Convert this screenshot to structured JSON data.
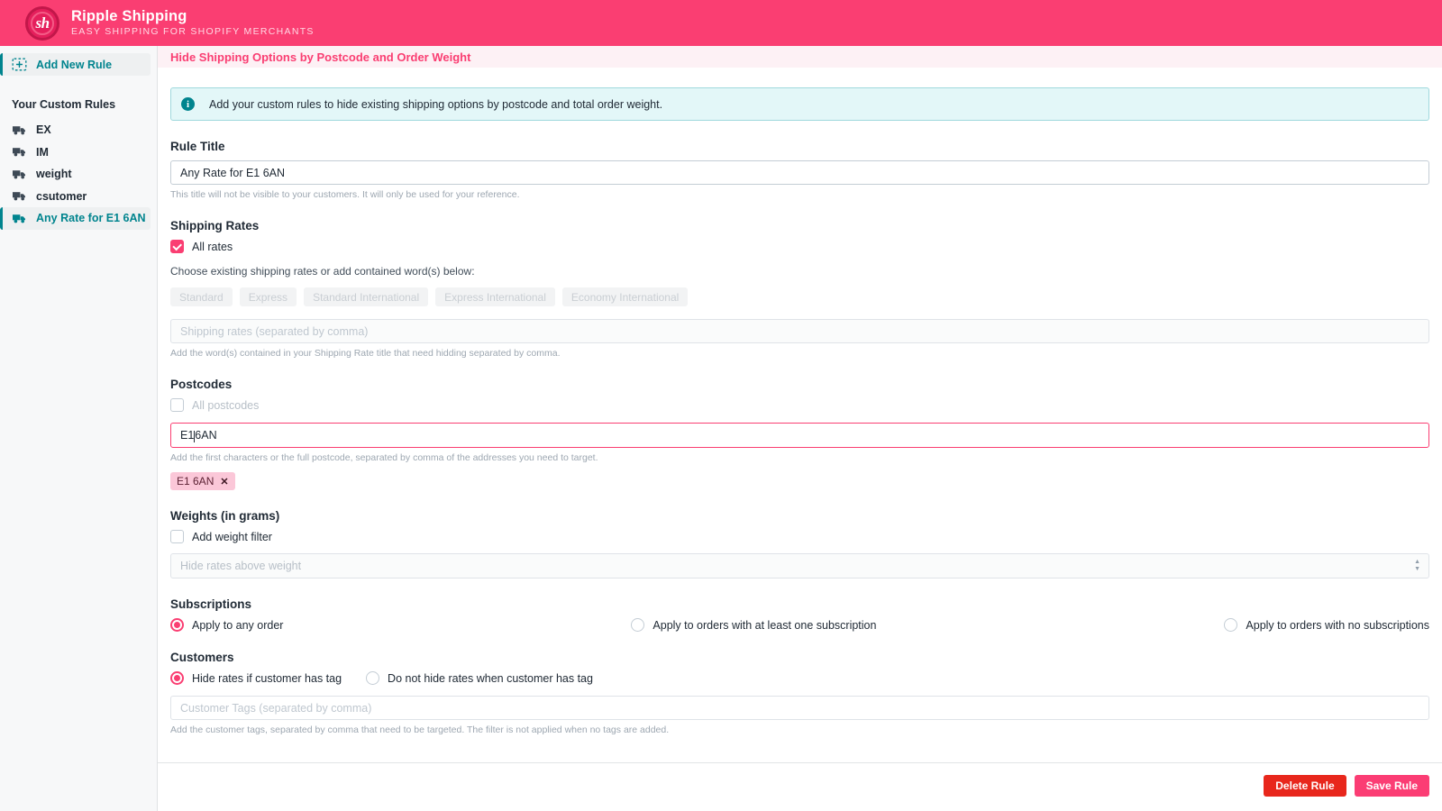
{
  "brand": {
    "logo_text": "sh",
    "title": "Ripple Shipping",
    "subtitle": "EASY SHIPPING FOR SHOPIFY MERCHANTS",
    "bar_color": "#fa3e72"
  },
  "sidebar": {
    "add_new_rule": "Add New Rule",
    "heading": "Your Custom Rules",
    "accent_color": "#00848e",
    "rules": [
      {
        "label": "EX",
        "active": false
      },
      {
        "label": "IM",
        "active": false
      },
      {
        "label": "weight",
        "active": false
      },
      {
        "label": "csutomer",
        "active": false
      },
      {
        "label": "Any Rate for E1 6AN",
        "active": true
      }
    ]
  },
  "page": {
    "title": "Hide Shipping Options by Postcode and Order Weight",
    "title_color": "#fa3e72",
    "banner": "Add your custom rules to hide existing shipping options by postcode and total order weight."
  },
  "rule_title": {
    "heading": "Rule Title",
    "value": "Any Rate for E1 6AN",
    "helper": "This title will not be visible to your customers. It will only be used for your reference."
  },
  "shipping_rates": {
    "heading": "Shipping Rates",
    "all_rates_label": "All rates",
    "all_rates_checked": true,
    "choose_label": "Choose existing shipping rates or add contained word(s) below:",
    "options": [
      "Standard",
      "Express",
      "Standard International",
      "Express International",
      "Economy International"
    ],
    "input_placeholder": "Shipping rates (separated by comma)",
    "input_value": "",
    "helper": "Add the word(s) contained in your Shipping Rate title that need hidding separated by comma."
  },
  "postcodes": {
    "heading": "Postcodes",
    "all_postcodes_label": "All postcodes",
    "all_postcodes_checked": false,
    "input_value_before_caret": "E1",
    "input_value_after_caret": "6AN",
    "helper": "Add the first characters or the full postcode, separated by comma of the addresses you need to target.",
    "tags": [
      {
        "label": "E1 6AN",
        "remove": "✕"
      }
    ]
  },
  "weights": {
    "heading": "Weights (in grams)",
    "add_filter_label": "Add weight filter",
    "add_filter_checked": false,
    "select_value": "Hide rates above weight"
  },
  "subscriptions": {
    "heading": "Subscriptions",
    "options": [
      {
        "label": "Apply to any order",
        "selected": true
      },
      {
        "label": "Apply to orders with at least one subscription",
        "selected": false
      },
      {
        "label": "Apply to orders with no subscriptions",
        "selected": false
      }
    ]
  },
  "customers": {
    "heading": "Customers",
    "options": [
      {
        "label": "Hide rates if customer has tag",
        "selected": true
      },
      {
        "label": "Do not hide rates when customer has tag",
        "selected": false
      }
    ],
    "input_placeholder": "Customer Tags (separated by comma)",
    "input_value": "",
    "helper": "Add the customer tags, separated by comma that need to be targeted. The filter is not applied when no tags are added."
  },
  "footer": {
    "delete_label": "Delete Rule",
    "save_label": "Save Rule",
    "delete_color": "#e8271c",
    "save_color": "#fb3d74"
  }
}
